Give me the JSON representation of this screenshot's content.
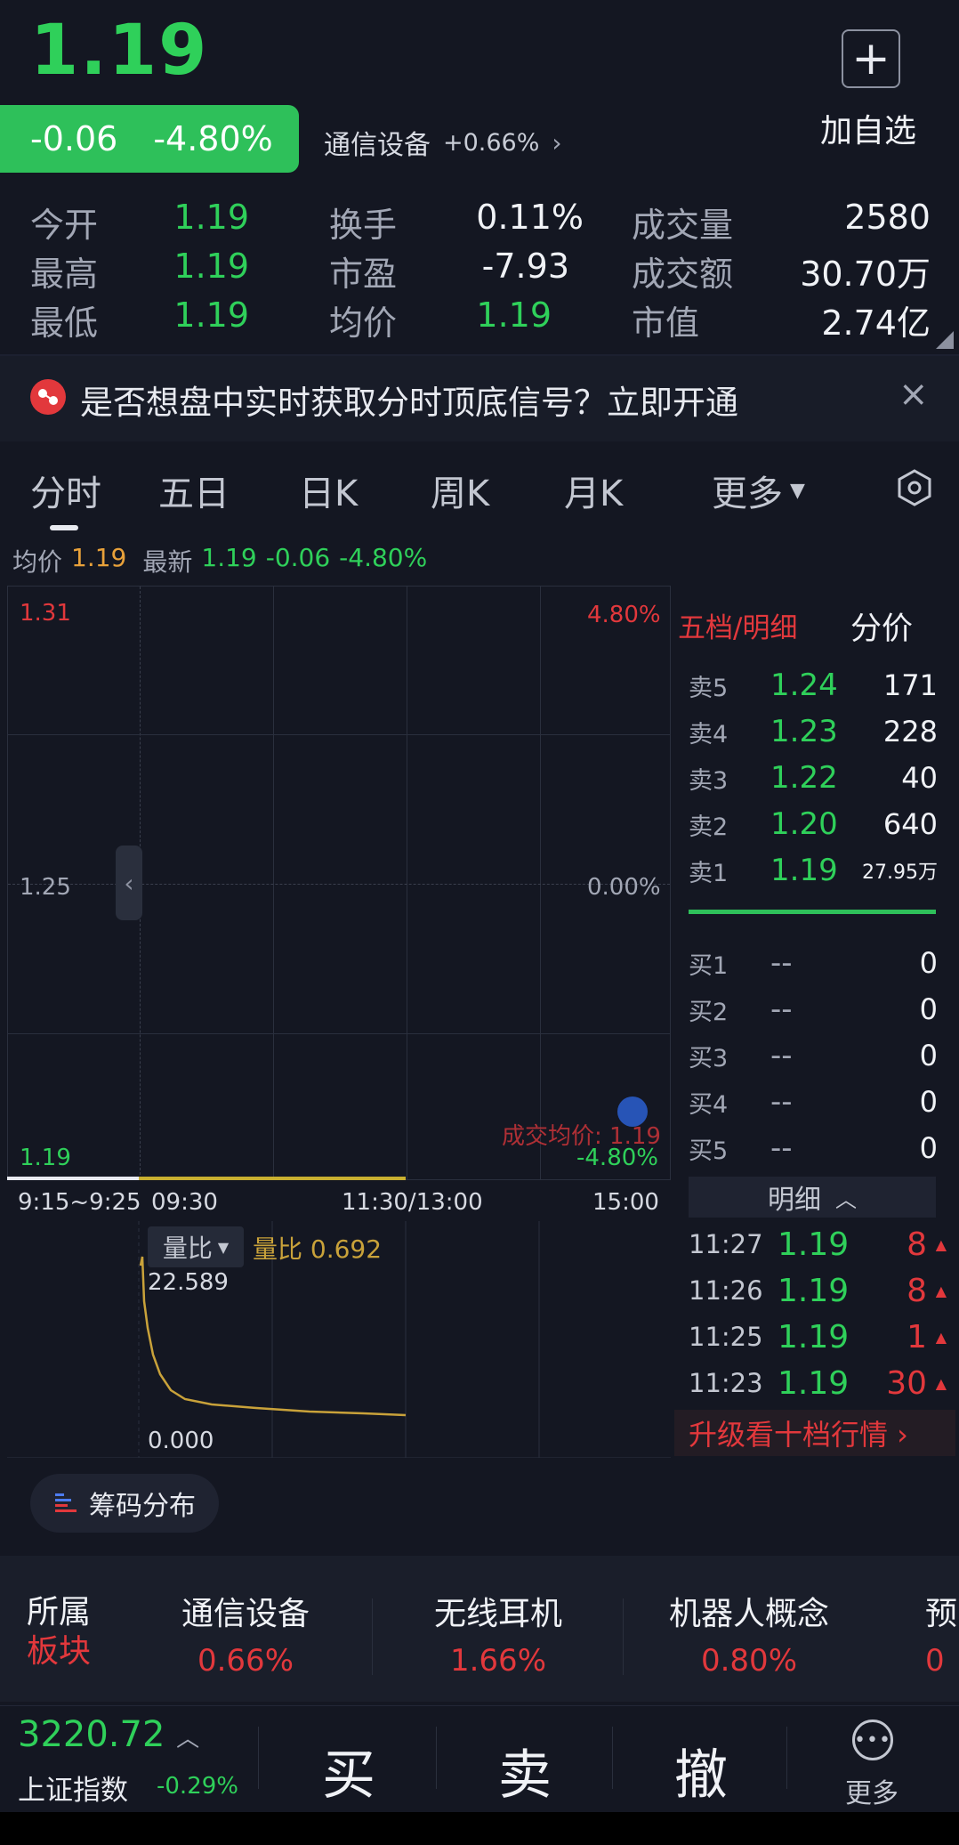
{
  "header": {
    "price": "1.19",
    "change": "-0.06",
    "change_pct": "-4.80%",
    "sector_name": "通信设备",
    "sector_pct": "+0.66%",
    "add_icon": "plus-icon",
    "add_label": "加自选"
  },
  "stats": [
    {
      "label": "今开",
      "value": "1.19",
      "color": "green"
    },
    {
      "label": "换手",
      "value": "0.11%",
      "color": "white"
    },
    {
      "label": "成交量",
      "value": "2580",
      "color": "white"
    },
    {
      "label": "最高",
      "value": "1.19",
      "color": "green"
    },
    {
      "label": "市盈",
      "value": "-7.93",
      "color": "white"
    },
    {
      "label": "成交额",
      "value": "30.70万",
      "color": "white"
    },
    {
      "label": "最低",
      "value": "1.19",
      "color": "green"
    },
    {
      "label": "均价",
      "value": "1.19",
      "color": "green"
    },
    {
      "label": "市值",
      "value": "2.74亿",
      "color": "white"
    }
  ],
  "banner": {
    "text": "是否想盘中实时获取分时顶底信号？立即开通",
    "close": "×"
  },
  "tabs": [
    "分时",
    "五日",
    "日K",
    "周K",
    "月K",
    "更多"
  ],
  "chart_info": {
    "avg_label": "均价",
    "avg_value": "1.19",
    "latest_label": "最新",
    "latest_value": "1.19",
    "change": "-0.06",
    "change_pct": "-4.80%"
  },
  "chart": {
    "y_top": "1.31",
    "y_mid": "1.25",
    "y_bot": "1.19",
    "pct_top": "4.80%",
    "pct_mid": "0.00%",
    "pct_bot": "-4.80%",
    "avg_deal_label": "成交均价: 1.19",
    "x_labels": [
      "9:15~9:25",
      "09:30",
      "11:30/13:00",
      "15:00"
    ]
  },
  "order_book": {
    "title": "五档/明细",
    "price_title": "分价",
    "asks": [
      {
        "label": "卖5",
        "price": "1.24",
        "qty": "171"
      },
      {
        "label": "卖4",
        "price": "1.23",
        "qty": "228"
      },
      {
        "label": "卖3",
        "price": "1.22",
        "qty": "40"
      },
      {
        "label": "卖2",
        "price": "1.20",
        "qty": "640"
      },
      {
        "label": "卖1",
        "price": "1.19",
        "qty": "27.95万"
      }
    ],
    "bids": [
      {
        "label": "买1",
        "price": "--",
        "qty": "0"
      },
      {
        "label": "买2",
        "price": "--",
        "qty": "0"
      },
      {
        "label": "买3",
        "price": "--",
        "qty": "0"
      },
      {
        "label": "买4",
        "price": "--",
        "qty": "0"
      },
      {
        "label": "买5",
        "price": "--",
        "qty": "0"
      }
    ],
    "detail_label": "明细",
    "ticks": [
      {
        "time": "11:27",
        "price": "1.19",
        "vol": "8"
      },
      {
        "time": "11:26",
        "price": "1.19",
        "vol": "8"
      },
      {
        "time": "11:25",
        "price": "1.19",
        "vol": "1"
      },
      {
        "time": "11:23",
        "price": "1.19",
        "vol": "30"
      }
    ],
    "upgrade": "升级看十档行情 ›"
  },
  "volume_ratio": {
    "chip": "量比",
    "label": "量比 0.692",
    "max": "22.589",
    "min": "0.000",
    "color": "#c9a23a"
  },
  "chips_button": "筹码分布",
  "sectors": {
    "tag_line1": "所属",
    "tag_line2": "板块",
    "items": [
      {
        "name": "通信设备",
        "pct": "0.66%"
      },
      {
        "name": "无线耳机",
        "pct": "1.66%"
      },
      {
        "name": "机器人概念",
        "pct": "0.80%"
      },
      {
        "name": "预",
        "pct": "0"
      }
    ]
  },
  "bottom_bar": {
    "index_value": "3220.72",
    "index_name": "上证指数",
    "index_change": "-0.29%",
    "buy": "买",
    "sell": "卖",
    "cancel": "撤",
    "more": "更多"
  },
  "colors": {
    "down": "#2fd05a",
    "up": "#e2383c",
    "avg_line": "#c9a23a",
    "background": "#141722"
  }
}
